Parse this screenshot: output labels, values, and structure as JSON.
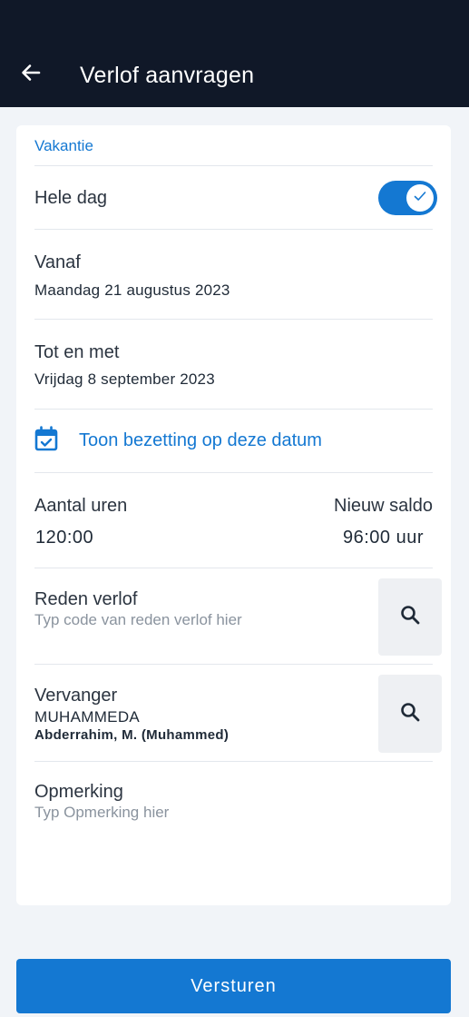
{
  "header": {
    "title": "Verlof aanvragen",
    "back_icon": "arrow-left-icon"
  },
  "form": {
    "leave_type": "Vakantie",
    "full_day": {
      "label": "Hele dag",
      "checked": true
    },
    "from": {
      "label": "Vanaf",
      "value": "Maandag 21 augustus 2023"
    },
    "until": {
      "label": "Tot en met",
      "value": "Vrijdag 8 september 2023"
    },
    "occupancy_link": {
      "label": "Toon bezetting op deze datum",
      "icon": "calendar-check-icon"
    },
    "hours": {
      "label": "Aantal uren",
      "value": "120:00",
      "balance_label": "Nieuw saldo",
      "balance_value": "96:00 uur"
    },
    "reason": {
      "label": "Reden verlof",
      "placeholder": "Typ code van reden verlof hier",
      "icon": "search-icon"
    },
    "substitute": {
      "label": "Vervanger",
      "code": "MUHAMMEDA",
      "name": "Abderrahim, M. (Muhammed)",
      "icon": "search-icon"
    },
    "remark": {
      "label": "Opmerking",
      "placeholder": "Typ Opmerking hier"
    }
  },
  "actions": {
    "submit_label": "Versturen"
  },
  "colors": {
    "appbar": "#101828",
    "accent": "#1478d2",
    "background": "#f1f4f8"
  }
}
